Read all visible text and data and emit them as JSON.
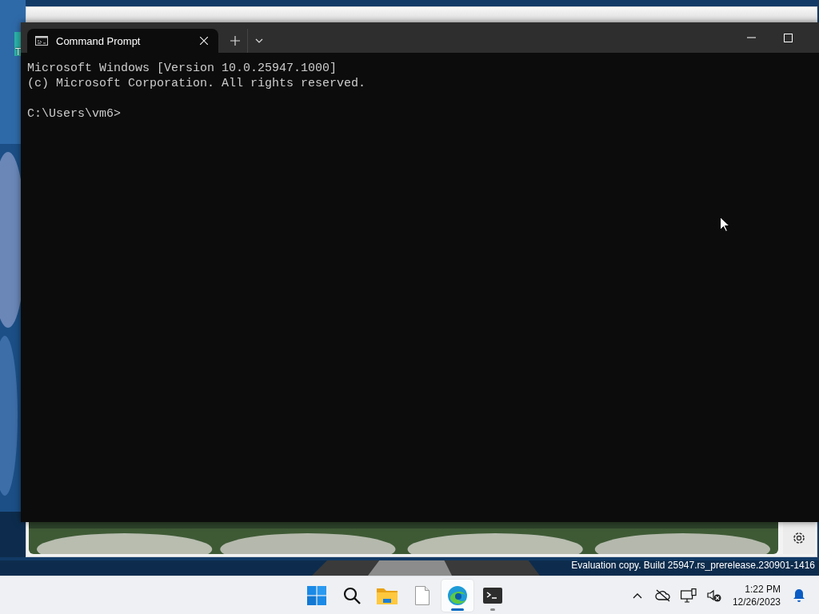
{
  "desktop": {
    "icon_label": "T",
    "watermark": "Evaluation copy. Build 25947.rs_prerelease.230901-1416"
  },
  "terminal": {
    "tabs": [
      {
        "title": "Command Prompt",
        "selected": true
      }
    ],
    "output": [
      "Microsoft Windows [Version 10.0.25947.1000]",
      "(c) Microsoft Corporation. All rights reserved."
    ],
    "prompt": "C:\\Users\\vm6>"
  },
  "taskbar": {
    "apps": [
      {
        "kind": "start",
        "selected": false,
        "running": false
      },
      {
        "kind": "search",
        "selected": false,
        "running": false
      },
      {
        "kind": "explorer",
        "selected": false,
        "running": false
      },
      {
        "kind": "notepad",
        "selected": false,
        "running": false
      },
      {
        "kind": "edge",
        "selected": true,
        "running": true
      },
      {
        "kind": "terminal",
        "selected": false,
        "running": true
      }
    ],
    "clock": {
      "time": "1:22 PM",
      "date": "12/26/2023"
    }
  }
}
